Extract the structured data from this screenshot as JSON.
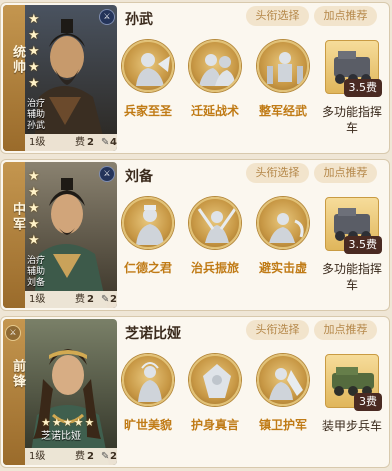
{
  "pill_title_label": "头衔选择",
  "pill_rec_label": "加点推荐",
  "generals": [
    {
      "position": "统帅",
      "name": "孙武",
      "roles": [
        "治疗",
        "辅助",
        "孙武"
      ],
      "stars": 5,
      "level": "1级",
      "cost_label": "费",
      "cost": "2",
      "feather_count": "4",
      "skills": [
        "兵家至圣",
        "迁延战术",
        "整军经武"
      ],
      "equipment": {
        "name": "多功能指挥车",
        "cost": "3.5费"
      }
    },
    {
      "position": "中军",
      "name": "刘备",
      "roles": [
        "治疗",
        "辅助",
        "刘备"
      ],
      "stars": 5,
      "level": "1级",
      "cost_label": "费",
      "cost": "2",
      "feather_count": "2",
      "skills": [
        "仁德之君",
        "治兵振旅",
        "避实击虚"
      ],
      "equipment": {
        "name": "多功能指挥车",
        "cost": "3.5费"
      }
    },
    {
      "position": "前锋",
      "name": "芝诺比娅",
      "roles": [
        "芝诺比娅"
      ],
      "stars": 5,
      "level": "1级",
      "cost_label": "费",
      "cost": "2",
      "feather_count": "2",
      "skills": [
        "旷世美貌",
        "护身真言",
        "镇卫护军"
      ],
      "equipment": {
        "name": "装甲步兵车",
        "cost": "3费"
      }
    }
  ],
  "colors": {
    "accent_gold": "#c07b16",
    "strip": "#b07f3a",
    "pill_bg": "#f2e4cc"
  }
}
